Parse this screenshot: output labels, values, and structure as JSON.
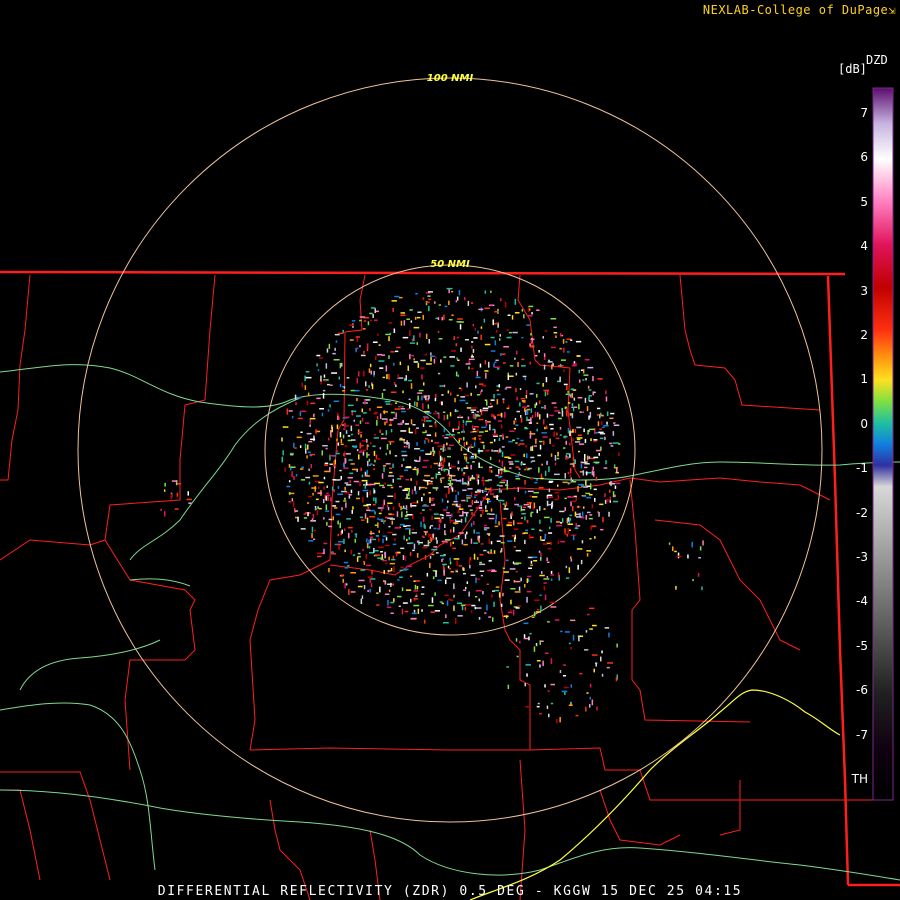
{
  "credit": "NEXLAB-College of DuPage",
  "credit_icon": "external-link-icon",
  "caption": "DIFFERENTIAL REFLECTIVITY (ZDR) 0.5 DEG - KGGW 15 DEC 25 04:15",
  "ring_labels": {
    "outer": "100 NMI",
    "inner": "50 NMI"
  },
  "color_scale": {
    "title": "DZD",
    "unit": "[dB]",
    "ticks": [
      "7",
      "6",
      "5",
      "4",
      "3",
      "2",
      "1",
      "0",
      "-1",
      "-2",
      "-3",
      "-4",
      "-5",
      "-6",
      "-7",
      "TH"
    ]
  },
  "colors": {
    "background": "#000000",
    "boundary": "#ff1e1e",
    "river": "#7fd88f",
    "highway": "#ffff3c",
    "range_ring": "#f0c29a",
    "label": "#ffd21f"
  }
}
